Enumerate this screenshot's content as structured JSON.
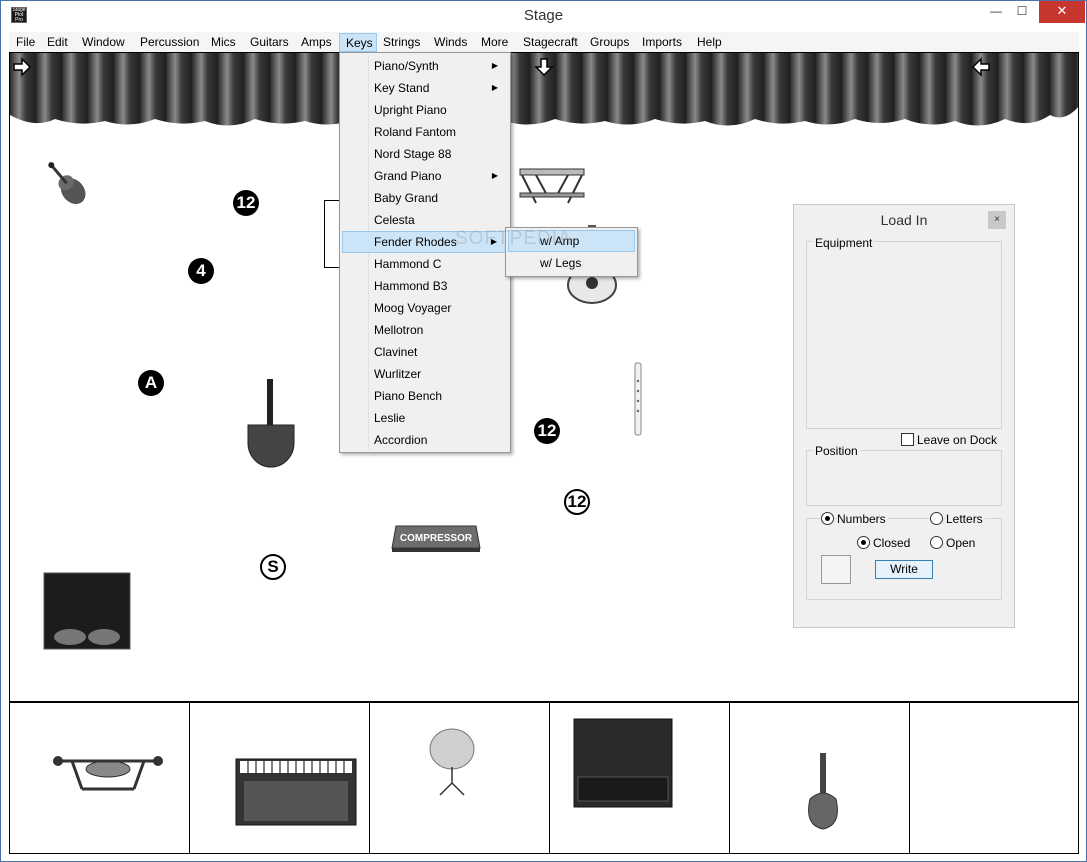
{
  "window": {
    "title": "Stage",
    "icon_text": "Stage Plot Pro"
  },
  "titlebar_buttons": {
    "minimize": "—",
    "maximize": "☐",
    "close": "✕"
  },
  "menubar": [
    {
      "label": "File"
    },
    {
      "label": "Edit"
    },
    {
      "label": "Window"
    },
    {
      "label": "Percussion"
    },
    {
      "label": "Mics"
    },
    {
      "label": "Guitars"
    },
    {
      "label": "Amps"
    },
    {
      "label": "Keys"
    },
    {
      "label": "Strings"
    },
    {
      "label": "Winds"
    },
    {
      "label": "More"
    },
    {
      "label": "Stagecraft"
    },
    {
      "label": "Groups"
    },
    {
      "label": "Imports"
    },
    {
      "label": "Help"
    }
  ],
  "keys_menu": [
    {
      "label": "Piano/Synth",
      "submenu_arrow": "▶"
    },
    {
      "label": "Key Stand",
      "submenu_arrow": "▶"
    },
    {
      "label": "Upright Piano",
      "submenu_arrow": ""
    },
    {
      "label": "Roland Fantom",
      "submenu_arrow": ""
    },
    {
      "label": "Nord Stage 88",
      "submenu_arrow": ""
    },
    {
      "label": "Grand Piano",
      "submenu_arrow": "▶"
    },
    {
      "label": "Baby Grand",
      "submenu_arrow": ""
    },
    {
      "label": "Celesta",
      "submenu_arrow": ""
    },
    {
      "label": "Fender Rhodes",
      "submenu_arrow": "▶"
    },
    {
      "label": "Hammond C",
      "submenu_arrow": ""
    },
    {
      "label": "Hammond B3",
      "submenu_arrow": ""
    },
    {
      "label": "Moog Voyager",
      "submenu_arrow": ""
    },
    {
      "label": "Mellotron",
      "submenu_arrow": ""
    },
    {
      "label": "Clavinet",
      "submenu_arrow": ""
    },
    {
      "label": "Wurlitzer",
      "submenu_arrow": ""
    },
    {
      "label": "Piano Bench",
      "submenu_arrow": ""
    },
    {
      "label": "Leslie",
      "submenu_arrow": ""
    },
    {
      "label": "Accordion",
      "submenu_arrow": ""
    }
  ],
  "fender_rhodes_submenu": [
    {
      "label": "w/ Amp"
    },
    {
      "label": "w/ Legs"
    }
  ],
  "watermark": "SOFTPEDIA",
  "stage_badges": {
    "b1": "12",
    "b2": "4",
    "b3": "A",
    "b4": "12",
    "b5": "12",
    "b6": "S"
  },
  "stage_items": {
    "compressor_label": "COMPRESSOR"
  },
  "load_in_panel": {
    "title": "Load In",
    "close": "×",
    "equipment_label": "Equipment",
    "leave_on_dock_label": "Leave on Dock",
    "position_label": "Position",
    "numbers_label": "Numbers",
    "letters_label": "Letters",
    "closed_label": "Closed",
    "open_label": "Open",
    "write_label": "Write",
    "numbers_selected": true,
    "closed_selected": true,
    "leave_on_dock_checked": false
  },
  "colors": {
    "menu_highlight": "#cce4f7",
    "close_button": "#c7372f"
  }
}
